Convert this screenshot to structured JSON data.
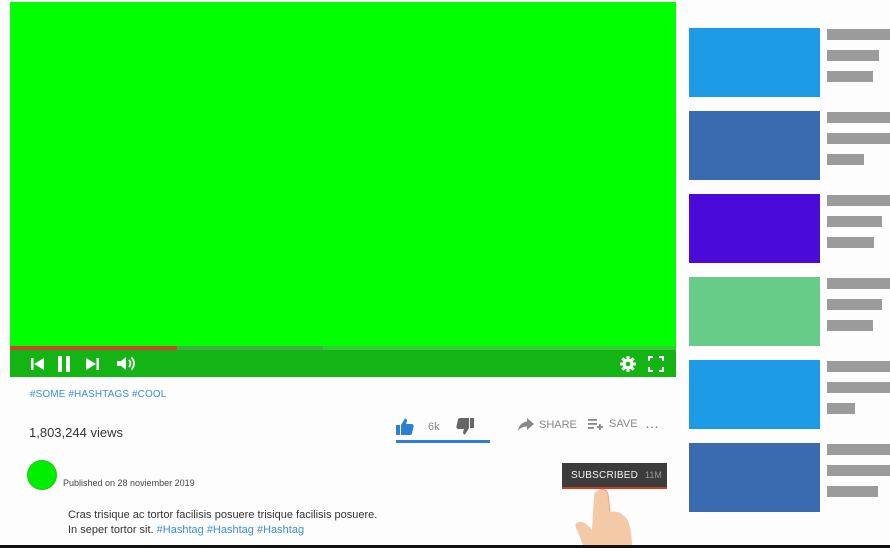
{
  "player": {
    "screen_color": "#00ff00",
    "progress_played_fraction": 0.25,
    "progress_buffered_fraction": 0.47,
    "controls": {
      "prev_icon": "skip-previous-icon",
      "pause_icon": "pause-icon",
      "next_icon": "skip-next-icon",
      "volume_icon": "volume-icon",
      "settings_icon": "gear-icon",
      "fullscreen_icon": "fullscreen-icon"
    }
  },
  "video": {
    "hashtags": "#SOME #HASHTAGS #COOL",
    "views": "1,803,244 views",
    "like_count": "6k",
    "like_ratio": 1.0,
    "share_label": "SHARE",
    "save_label": "SAVE",
    "more_label": "…"
  },
  "channel": {
    "published": "Published on 28 noviember 2019",
    "subscribe_label": "SUBSCRIBED",
    "subscriber_count": "11M",
    "avatar_color": "#00ee00"
  },
  "description": {
    "line1": "Cras trisique ac tortor facilisis posuere trisique facilisis posuere.",
    "line2_text": "In seper tortor sit.",
    "line2_tags": [
      "#Hashtag",
      "#Hashtag",
      "#Hashtag"
    ]
  },
  "sidebar": {
    "recommendations": [
      {
        "thumb_color": "#1e9be6"
      },
      {
        "thumb_color": "#3a6bb1"
      },
      {
        "thumb_color": "#4a0bd8"
      },
      {
        "thumb_color": "#66cc88"
      },
      {
        "thumb_color": "#1e9be6"
      },
      {
        "thumb_color": "#3a6bb1"
      }
    ]
  }
}
